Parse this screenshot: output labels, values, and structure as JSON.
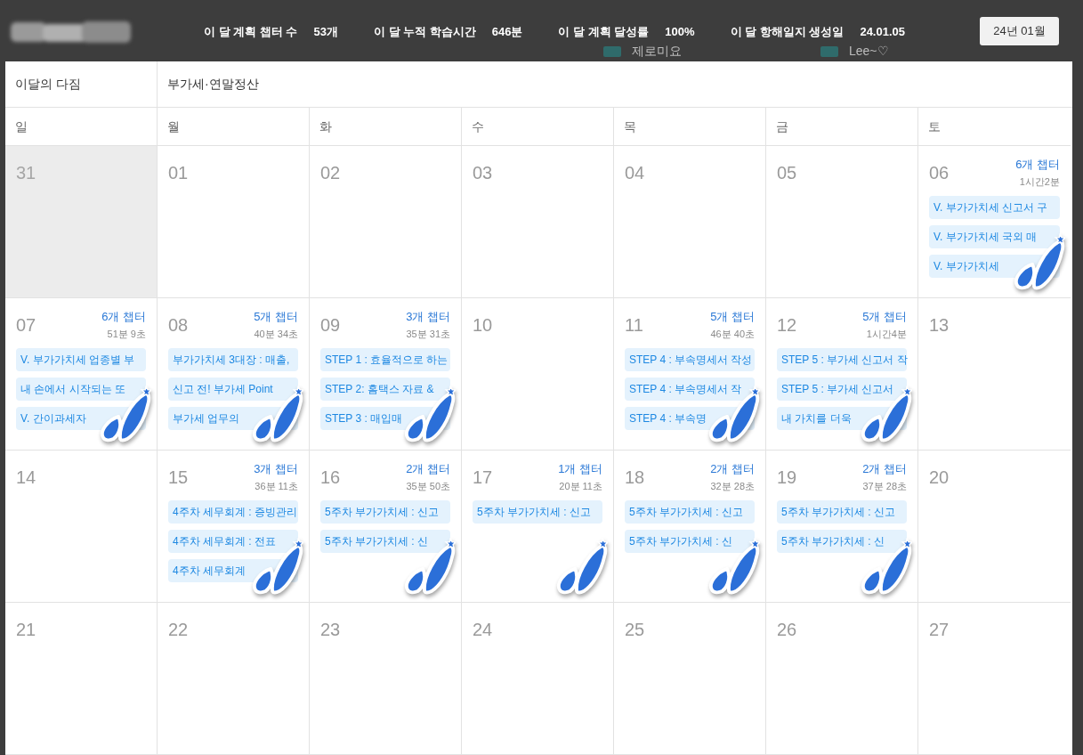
{
  "header": {
    "stats": [
      {
        "label": "이 달 계획 챕터 수",
        "value": "53개"
      },
      {
        "label": "이 달 누적 학습시간",
        "value": "646분"
      },
      {
        "label": "이 달 계획 달성률",
        "value": "100%"
      },
      {
        "label": "이 달 항해일지 생성일",
        "value": "24.01.05"
      }
    ],
    "month_button": "24년 01월",
    "behind_names": [
      "제로미요",
      "Lee~♡"
    ]
  },
  "goal": {
    "label": "이달의 다짐",
    "value": "부가세·연말정산"
  },
  "weekdays": [
    "일",
    "월",
    "화",
    "수",
    "목",
    "금",
    "토"
  ],
  "weeks": [
    [
      {
        "date": "31",
        "other_month": true
      },
      {
        "date": "01",
        "other_month": false
      },
      {
        "date": "02",
        "other_month": false
      },
      {
        "date": "03",
        "other_month": false
      },
      {
        "date": "04",
        "other_month": false
      },
      {
        "date": "05",
        "other_month": false
      },
      {
        "date": "06",
        "other_month": false,
        "chapters": "6개 챕터",
        "duration": "1시간2분",
        "stamped": true,
        "items": [
          "V. 부가가치세 신고서 구",
          "V. 부가가치세 국외 매",
          "V. 부가가치세"
        ]
      }
    ],
    [
      {
        "date": "07",
        "other_month": false,
        "chapters": "6개 챕터",
        "duration": "51분 9초",
        "stamped": true,
        "items": [
          "V. 부가가치세 업종별 부",
          "내 손에서 시작되는 또",
          "V. 간이과세자"
        ]
      },
      {
        "date": "08",
        "other_month": false,
        "chapters": "5개 챕터",
        "duration": "40분 34초",
        "stamped": true,
        "items": [
          "부가가치세 3대장 : 매출,",
          "신고 전! 부가세 Point",
          "부가세 업무의"
        ]
      },
      {
        "date": "09",
        "other_month": false,
        "chapters": "3개 챕터",
        "duration": "35분 31초",
        "stamped": true,
        "items": [
          "STEP 1 : 효율적으로 하는",
          "STEP 2: 홈택스 자료 &",
          "STEP 3 : 매입매"
        ]
      },
      {
        "date": "10",
        "other_month": false
      },
      {
        "date": "11",
        "other_month": false,
        "chapters": "5개 챕터",
        "duration": "46분 40초",
        "stamped": true,
        "items": [
          "STEP 4 : 부속명세서 작성",
          "STEP 4 : 부속명세서 작",
          "STEP 4 : 부속명"
        ]
      },
      {
        "date": "12",
        "other_month": false,
        "chapters": "5개 챕터",
        "duration": "1시간4분",
        "stamped": true,
        "items": [
          "STEP 5 : 부가세 신고서 작",
          "STEP 5 : 부가세 신고서",
          "내 가치를 더욱"
        ]
      },
      {
        "date": "13",
        "other_month": false
      }
    ],
    [
      {
        "date": "14",
        "other_month": false
      },
      {
        "date": "15",
        "other_month": false,
        "chapters": "3개 챕터",
        "duration": "36분 11초",
        "stamped": true,
        "items": [
          "4주차 세무회계 : 증빙관리",
          "4주차 세무회계 : 전표",
          "4주차 세무회계"
        ]
      },
      {
        "date": "16",
        "other_month": false,
        "chapters": "2개 챕터",
        "duration": "35분 50초",
        "stamped": true,
        "items": [
          "5주차 부가가치세 : 신고",
          "5주차 부가가치세 : 신"
        ]
      },
      {
        "date": "17",
        "other_month": false,
        "chapters": "1개 챕터",
        "duration": "20분 11초",
        "stamped": true,
        "items": [
          "5주차 부가가치세 : 신고"
        ]
      },
      {
        "date": "18",
        "other_month": false,
        "chapters": "2개 챕터",
        "duration": "32분 28초",
        "stamped": true,
        "items": [
          "5주차 부가가치세 : 신고",
          "5주차 부가가치세 : 신"
        ]
      },
      {
        "date": "19",
        "other_month": false,
        "chapters": "2개 챕터",
        "duration": "37분 28초",
        "stamped": true,
        "items": [
          "5주차 부가가치세 : 신고",
          "5주차 부가가치세 : 신"
        ]
      },
      {
        "date": "20",
        "other_month": false
      }
    ],
    [
      {
        "date": "21",
        "other_month": false
      },
      {
        "date": "22",
        "other_month": false
      },
      {
        "date": "23",
        "other_month": false
      },
      {
        "date": "24",
        "other_month": false
      },
      {
        "date": "25",
        "other_month": false
      },
      {
        "date": "26",
        "other_month": false
      },
      {
        "date": "27",
        "other_month": false
      }
    ]
  ]
}
